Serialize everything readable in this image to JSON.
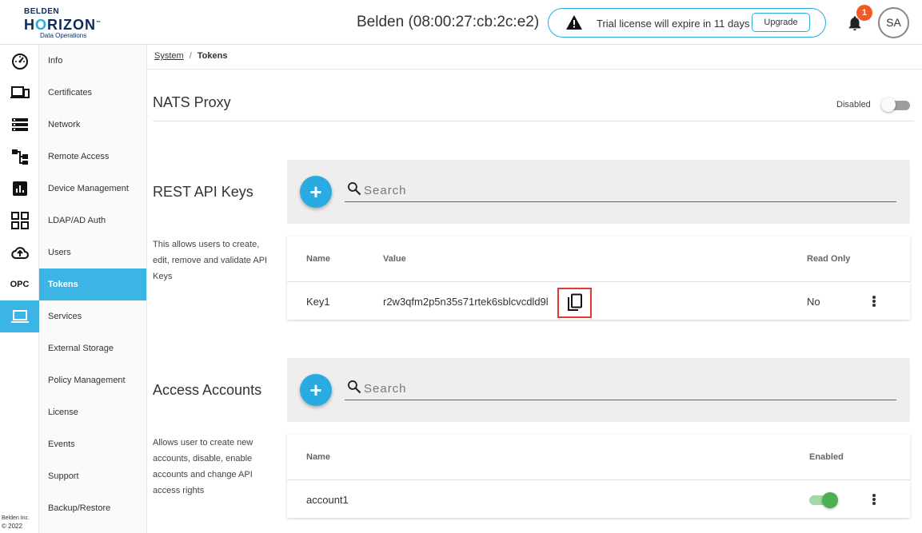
{
  "header": {
    "logo_line1": "BELDEN",
    "logo_line2_a": "H",
    "logo_line2_o": "O",
    "logo_line2_b": "RIZON",
    "logo_tm": "™",
    "logo_line3": "Data Operations",
    "device_title": "Belden (08:00:27:cb:2c:e2)",
    "trial_text": "Trial license will expire in 11 days",
    "upgrade_label": "Upgrade",
    "notification_count": "1",
    "avatar_initials": "SA"
  },
  "rail": {
    "items": [
      "dashboard-icon",
      "devices-icon",
      "list-icon",
      "hierarchy-icon",
      "chart-icon",
      "apps-icon",
      "cloud-upload-icon",
      "opc-icon",
      "laptop-icon"
    ],
    "opc_label": "OPC",
    "footer_line1": "Belden Inc.",
    "footer_line2": "© 2022"
  },
  "subnav": {
    "items": [
      {
        "label": "Info"
      },
      {
        "label": "Certificates"
      },
      {
        "label": "Network"
      },
      {
        "label": "Remote Access"
      },
      {
        "label": "Device Management"
      },
      {
        "label": "LDAP/AD Auth"
      },
      {
        "label": "Users"
      },
      {
        "label": "Tokens"
      },
      {
        "label": "Services"
      },
      {
        "label": "External Storage"
      },
      {
        "label": "Policy Management"
      },
      {
        "label": "License"
      },
      {
        "label": "Events"
      },
      {
        "label": "Support"
      },
      {
        "label": "Backup/Restore"
      }
    ],
    "active_label": "Tokens"
  },
  "breadcrumb": {
    "root": "System",
    "separator": "/",
    "current": "Tokens"
  },
  "nats": {
    "title": "NATS Proxy",
    "status": "Disabled",
    "enabled": false
  },
  "rest_api": {
    "title": "REST API Keys",
    "description": "This allows users to create, edit, remove and validate API Keys",
    "search_placeholder": "Search",
    "add_label": "+",
    "columns": [
      "Name",
      "Value",
      "Read Only"
    ],
    "rows": [
      {
        "name": "Key1",
        "value": "r2w3qfm2p5n35s71rtek6sblcvcdld9l",
        "read_only": "No"
      }
    ]
  },
  "access_accounts": {
    "title": "Access Accounts",
    "description": "Allows user to create new accounts, disable, enable accounts and change API access rights",
    "search_placeholder": "Search",
    "add_label": "+",
    "columns": [
      "Name",
      "Enabled"
    ],
    "rows": [
      {
        "name": "account1",
        "enabled": true
      }
    ]
  },
  "colors": {
    "accent": "#29abe2",
    "nav_active": "#3cb4e5",
    "badge": "#f15a24",
    "highlight_border": "#e53935",
    "toggle_on": "#4caf50",
    "toggle_off": "#9e9e9e"
  }
}
